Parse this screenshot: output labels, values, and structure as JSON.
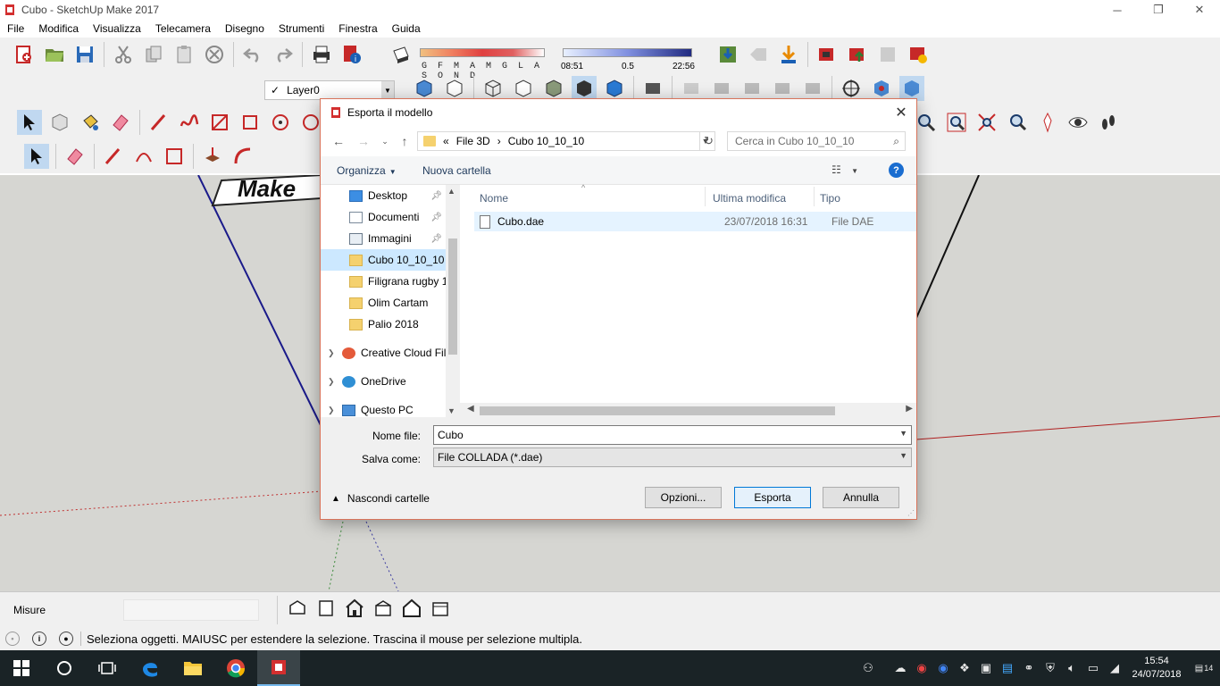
{
  "app": {
    "title": "Cubo - SketchUp Make 2017",
    "menu": [
      "File",
      "Modifica",
      "Visualizza",
      "Telecamera",
      "Disegno",
      "Strumenti",
      "Finestra",
      "Guida"
    ]
  },
  "toolbar": {
    "months": "G F M A M G L A S O N D",
    "time_start": "08:51",
    "time_mid": "0.5",
    "time_end": "22:56",
    "layer": "Layer0"
  },
  "viewport": {
    "model_text": "Make"
  },
  "measure": {
    "label": "Misure",
    "value": ""
  },
  "status": {
    "text": "Seleziona oggetti. MAIUSC per estendere la selezione. Trascina il mouse per selezione multipla."
  },
  "dialog": {
    "title": "Esporta il modello",
    "breadcrumb": [
      "«",
      "File 3D",
      "›",
      "Cubo 10_10_10"
    ],
    "search_placeholder": "Cerca in Cubo 10_10_10",
    "organize": "Organizza",
    "new_folder": "Nuova cartella",
    "nav_items": [
      {
        "label": "Desktop",
        "icon": "desktop-icon",
        "pinned": true
      },
      {
        "label": "Documenti",
        "icon": "documents-icon",
        "pinned": true
      },
      {
        "label": "Immagini",
        "icon": "pictures-icon",
        "pinned": true
      },
      {
        "label": "Cubo 10_10_10",
        "icon": "folder-icon",
        "selected": true
      },
      {
        "label": "Filigrana rugby 1",
        "icon": "folder-icon"
      },
      {
        "label": "Olim Cartam",
        "icon": "folder-icon"
      },
      {
        "label": "Palio 2018",
        "icon": "folder-icon"
      },
      {
        "label": "Creative Cloud Fil",
        "icon": "creative-cloud-icon"
      },
      {
        "label": "OneDrive",
        "icon": "onedrive-icon"
      },
      {
        "label": "Questo PC",
        "icon": "this-pc-icon"
      }
    ],
    "columns": [
      "Nome",
      "Ultima modifica",
      "Tipo"
    ],
    "files": [
      {
        "name": "Cubo.dae",
        "modified": "23/07/2018 16:31",
        "type": "File DAE"
      }
    ],
    "filename_label": "Nome file:",
    "filename_value": "Cubo",
    "savetype_label": "Salva come:",
    "savetype_value": "File COLLADA (*.dae)",
    "hide_folders": "Nascondi cartelle",
    "options_button": "Opzioni...",
    "export_button": "Esporta",
    "cancel_button": "Annulla"
  },
  "taskbar": {
    "time": "15:54",
    "date": "24/07/2018",
    "notifications": "14"
  },
  "colors": {
    "accent": "#0078d7",
    "dialog_border": "#d8735a",
    "selection": "#cce8ff",
    "taskbar": "#1a2326"
  }
}
